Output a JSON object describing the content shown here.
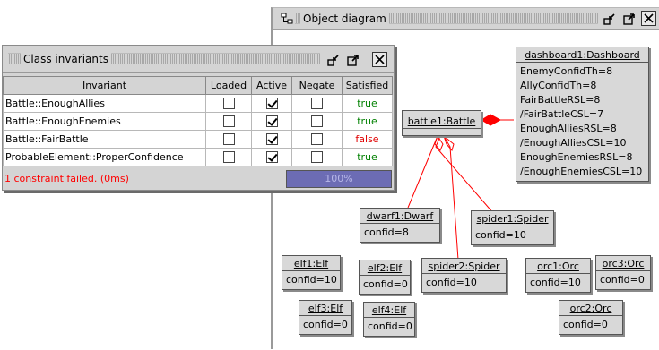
{
  "object_diagram": {
    "title": "Object diagram",
    "objects": [
      {
        "name": "dashboard1:Dashboard",
        "attrs": [
          "EnemyConfidTh=8",
          "AllyConfidTh=8",
          "FairBattleRSL=8",
          "/FairBattleCSL=7",
          "EnoughAlliesRSL=8",
          "/EnoughAlliesCSL=10",
          "EnoughEnemiesRSL=8",
          "/EnoughEnemiesCSL=10"
        ]
      },
      {
        "name": "battle1:Battle",
        "attrs": []
      },
      {
        "name": "dwarf1:Dwarf",
        "attrs": [
          "confid=8"
        ]
      },
      {
        "name": "spider1:Spider",
        "attrs": [
          "confid=10"
        ]
      },
      {
        "name": "elf1:Elf",
        "attrs": [
          "confid=10"
        ]
      },
      {
        "name": "elf2:Elf",
        "attrs": [
          "confid=0"
        ]
      },
      {
        "name": "spider2:Spider",
        "attrs": [
          "confid=10"
        ]
      },
      {
        "name": "orc1:Orc",
        "attrs": [
          "confid=10"
        ]
      },
      {
        "name": "orc3:Orc",
        "attrs": [
          "confid=0"
        ]
      },
      {
        "name": "elf3:Elf",
        "attrs": [
          "confid=0"
        ]
      },
      {
        "name": "elf4:Elf",
        "attrs": [
          "confid=0"
        ]
      },
      {
        "name": "orc2:Orc",
        "attrs": [
          "confid=0"
        ]
      }
    ]
  },
  "class_invariants": {
    "title": "Class invariants",
    "columns": [
      "Invariant",
      "Loaded",
      "Active",
      "Negate",
      "Satisfied"
    ],
    "rows": [
      {
        "invariant": "Battle::EnoughAllies",
        "loaded": false,
        "active": true,
        "negate": false,
        "satisfied": "true"
      },
      {
        "invariant": "Battle::EnoughEnemies",
        "loaded": false,
        "active": true,
        "negate": false,
        "satisfied": "true"
      },
      {
        "invariant": "Battle::FairBattle",
        "loaded": false,
        "active": true,
        "negate": false,
        "satisfied": "false"
      },
      {
        "invariant": "ProbableElement::ProperConfidence",
        "loaded": false,
        "active": true,
        "negate": false,
        "satisfied": "true"
      }
    ],
    "status": "1 constraint failed. (0ms)",
    "progress_label": "100%",
    "progress": 1.0
  },
  "colors": {
    "link": "#ff0000",
    "satisfied_true": "#008000",
    "satisfied_false": "#e00000",
    "progress_fill": "#6c6cb4"
  },
  "icons": [
    "object-diagram-icon",
    "minimize-icon",
    "maximize-icon",
    "close-icon"
  ]
}
